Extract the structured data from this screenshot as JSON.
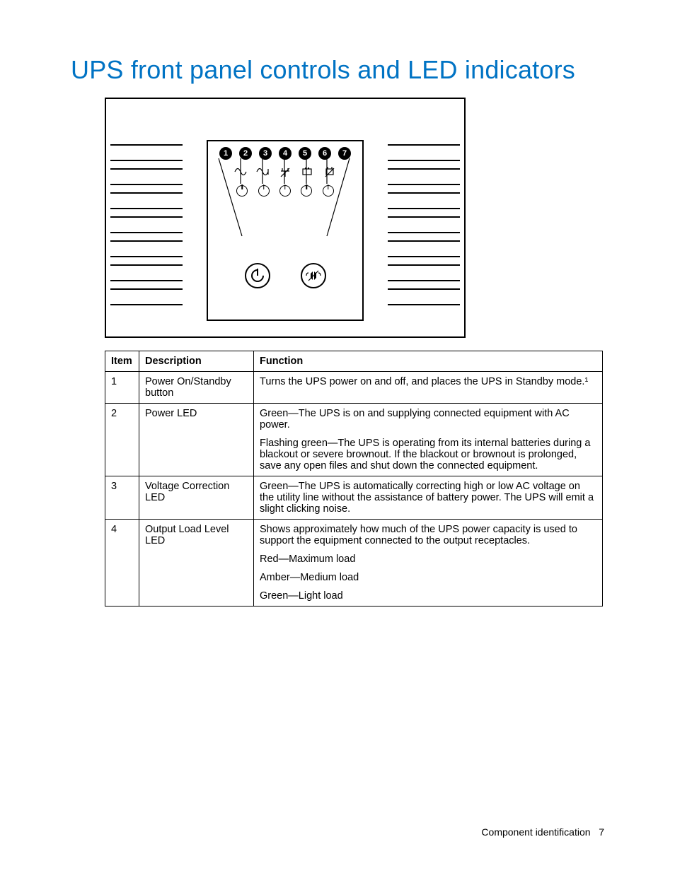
{
  "title": "UPS front panel controls and LED indicators",
  "diagram": {
    "callouts": [
      "1",
      "2",
      "3",
      "4",
      "5",
      "6",
      "7"
    ]
  },
  "table": {
    "headers": {
      "item": "Item",
      "desc": "Description",
      "func": "Function"
    },
    "rows": [
      {
        "item": "1",
        "desc": "Power On/Standby button",
        "func": [
          "Turns the UPS power on and off, and places the UPS in Standby mode.¹"
        ]
      },
      {
        "item": "2",
        "desc": "Power LED",
        "func": [
          "Green—The UPS is on and supplying connected equipment with AC power.",
          "Flashing green—The UPS is operating from its internal batteries during a blackout or severe brownout. If the blackout or brownout is prolonged, save any open files and shut down the connected equipment."
        ]
      },
      {
        "item": "3",
        "desc": "Voltage Correction LED",
        "func": [
          "Green—The UPS is automatically correcting high or low AC voltage on the utility line without the assistance of battery power. The UPS will emit a slight clicking noise."
        ]
      },
      {
        "item": "4",
        "desc": "Output Load Level LED",
        "func": [
          "Shows approximately how much of the UPS power capacity is used to support the equipment connected to the output receptacles.",
          "Red—Maximum load",
          "Amber—Medium load",
          "Green—Light load"
        ]
      }
    ]
  },
  "footer": {
    "section": "Component identification",
    "page": "7"
  }
}
